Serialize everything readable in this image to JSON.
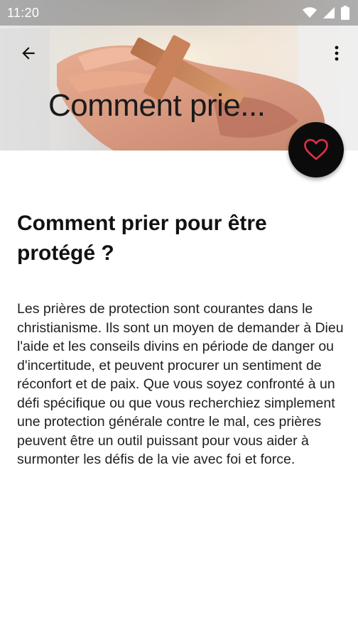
{
  "status_bar": {
    "time": "11:20",
    "icons": [
      "wifi-icon",
      "signal-icon",
      "battery-icon"
    ]
  },
  "toolbar": {
    "title": "Comment prie...",
    "back_icon": "arrow-back-icon",
    "menu_icon": "more-vert-icon"
  },
  "fab": {
    "icon": "heart-outline-icon",
    "icon_color": "#e0304a",
    "background": "#0b0b0b"
  },
  "article": {
    "title": "Comment prier pour être protégé ?",
    "body": "Les prières de protection sont courantes dans le christianisme. Ils sont un moyen de demander à Dieu l'aide et les conseils divins en période de danger ou d'incertitude, et peuvent procurer un sentiment de réconfort et de paix. Que vous soyez confronté à un défi spécifique ou que vous recherchiez simplement une protection générale contre le mal, ces prières peuvent être un outil puissant pour vous aider à surmonter les défis de la vie avec foi et force."
  }
}
